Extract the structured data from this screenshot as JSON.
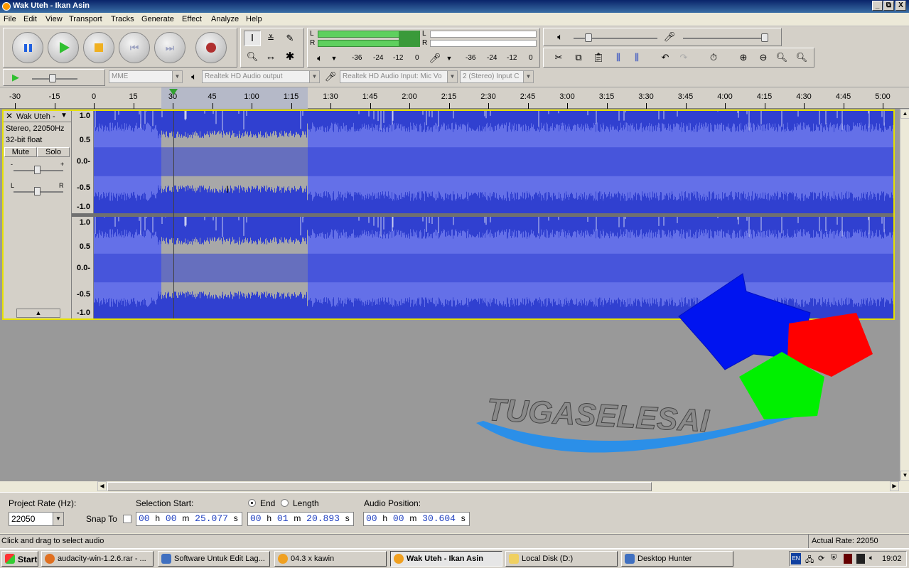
{
  "window": {
    "title": "Wak Uteh - Ikan Asin",
    "controls": [
      "_",
      "⧉",
      "X"
    ]
  },
  "menus": [
    "File",
    "Edit",
    "View",
    "Transport",
    "Tracks",
    "Generate",
    "Effect",
    "Analyze",
    "Help"
  ],
  "meter": {
    "L": "L",
    "R": "R",
    "ticks": [
      "-36",
      "-24",
      "-12",
      "0"
    ]
  },
  "device": {
    "host": "MME",
    "output": "Realtek HD Audio output",
    "input": "Realtek HD Audio Input: Mic Vo",
    "channels": "2 (Stereo) Input C"
  },
  "ruler_labels": [
    "-30",
    "-15",
    "0",
    "15",
    "30",
    "45",
    "1:00",
    "1:15",
    "1:30",
    "1:45",
    "2:00",
    "2:15",
    "2:30",
    "2:45",
    "3:00",
    "3:15",
    "3:30",
    "3:45",
    "4:00",
    "4:15",
    "4:30",
    "4:45",
    "5:00"
  ],
  "track": {
    "name": "Wak Uteh -",
    "format": "Stereo, 22050Hz",
    "sample": "32-bit float",
    "mute": "Mute",
    "solo": "Solo",
    "gain_minus": "-",
    "gain_plus": "+",
    "pan_left": "L",
    "pan_right": "R",
    "scale": [
      "1.0",
      "0.5",
      "0.0-",
      "-0.5",
      "-1.0"
    ]
  },
  "watermark": {
    "text": "TUGASELESAI"
  },
  "selection": {
    "rate_label": "Project Rate (Hz):",
    "rate": "22050",
    "snap_label": "Snap To",
    "start_label": "Selection Start:",
    "end_label": "End",
    "length_label": "Length",
    "audio_pos_label": "Audio Position:",
    "start": {
      "h": "00",
      "m": "00",
      "s": "25.077"
    },
    "end": {
      "h": "00",
      "m": "01",
      "s": "20.893"
    },
    "pos": {
      "h": "00",
      "m": "00",
      "s": "30.604"
    }
  },
  "status": {
    "hint": "Click and drag to select audio",
    "rate": "Actual Rate: 22050"
  },
  "taskbar": {
    "start": "Start",
    "items": [
      "audacity-win-1.2.6.rar - ...",
      "Software Untuk Edit Lag...",
      "04.3 x kawin",
      "Wak Uteh - Ikan Asin",
      "Local Disk (D:)",
      "Desktop Hunter"
    ],
    "lang": "EN",
    "clock": "19:02"
  },
  "colors": {
    "wave_bg": "#3040d0",
    "wave": "#6470e8",
    "selected": "#a8a8a8",
    "track_border": "#e6e000"
  }
}
